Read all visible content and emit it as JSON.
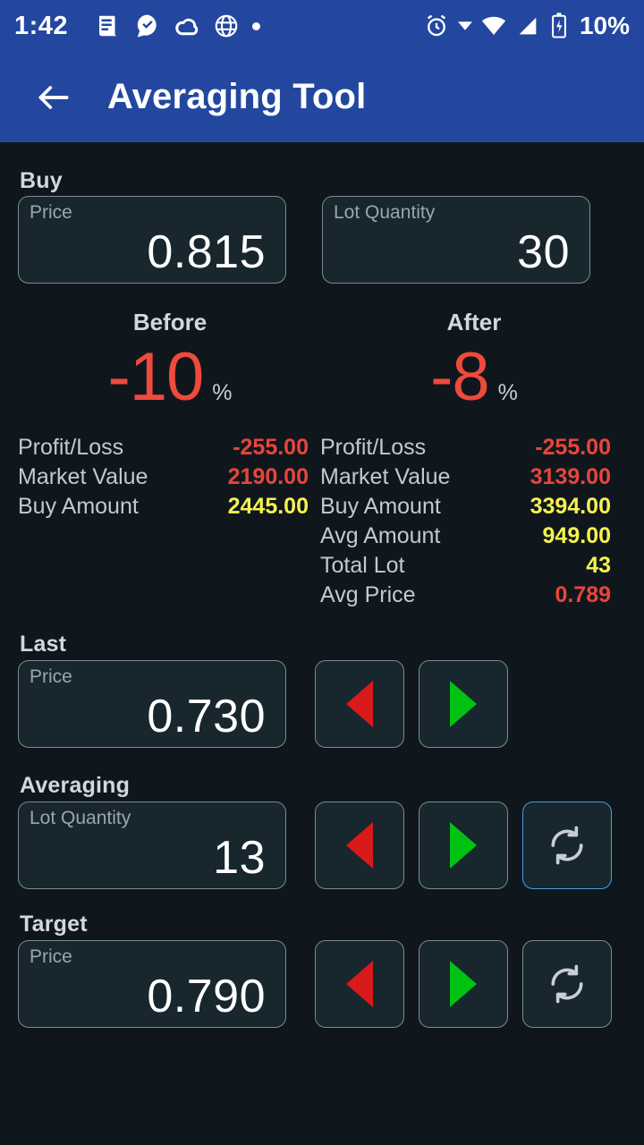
{
  "status_bar": {
    "time": "1:42",
    "battery_percent": "10%",
    "left_icons": [
      "news-icon",
      "chat-check-icon",
      "cloud-icon",
      "globe-icon",
      "dot-icon"
    ],
    "right_icons": [
      "alarm-icon",
      "dropdown-caret-icon",
      "wifi-icon",
      "signal-icon",
      "battery-charging-icon"
    ]
  },
  "appbar": {
    "back_label": "back-arrow",
    "title": "Averaging Tool",
    "background": "#23479f"
  },
  "buy": {
    "section_label": "Buy",
    "price": {
      "label": "Price",
      "value": "0.815"
    },
    "lot_quantity": {
      "label": "Lot Quantity",
      "value": "30"
    }
  },
  "comparison": {
    "before_label": "Before",
    "after_label": "After",
    "before_percent": "-10",
    "after_percent": "-8",
    "percent_symbol": "%",
    "percent_color": "#ef4a3c",
    "before_stats": [
      {
        "label": "Profit/Loss",
        "value": "-255.00",
        "color": "#e8453c"
      },
      {
        "label": "Market Value",
        "value": "2190.00",
        "color": "#e8453c"
      },
      {
        "label": "Buy Amount",
        "value": "2445.00",
        "color": "#f6f24f"
      }
    ],
    "after_stats": [
      {
        "label": "Profit/Loss",
        "value": "-255.00",
        "color": "#e8453c"
      },
      {
        "label": "Market Value",
        "value": "3139.00",
        "color": "#e8453c"
      },
      {
        "label": "Buy Amount",
        "value": "3394.00",
        "color": "#f6f24f"
      },
      {
        "label": "Avg Amount",
        "value": "949.00",
        "color": "#f6f24f"
      },
      {
        "label": "Total Lot",
        "value": "43",
        "color": "#f6f24f"
      },
      {
        "label": "Avg Price",
        "value": "0.789",
        "color": "#e8453c"
      }
    ]
  },
  "last": {
    "section_label": "Last",
    "field": {
      "label": "Price",
      "value": "0.730"
    },
    "decrement_icon": "triangle-left-icon",
    "increment_icon": "triangle-right-icon",
    "has_reset": false
  },
  "averaging": {
    "section_label": "Averaging",
    "field": {
      "label": "Lot Quantity",
      "value": "13"
    },
    "decrement_icon": "triangle-left-icon",
    "increment_icon": "triangle-right-icon",
    "reset_icon": "sync-icon",
    "reset_focused": true
  },
  "target": {
    "section_label": "Target",
    "field": {
      "label": "Price",
      "value": "0.790"
    },
    "decrement_icon": "triangle-left-icon",
    "increment_icon": "triangle-right-icon",
    "reset_icon": "sync-icon",
    "reset_focused": false
  },
  "theme": {
    "background": "#0f171d",
    "field_background": "#18262e",
    "field_border": "#7d8a92",
    "focus_border": "#4a9fe0",
    "red": "#d91a1a",
    "green": "#00c213"
  }
}
